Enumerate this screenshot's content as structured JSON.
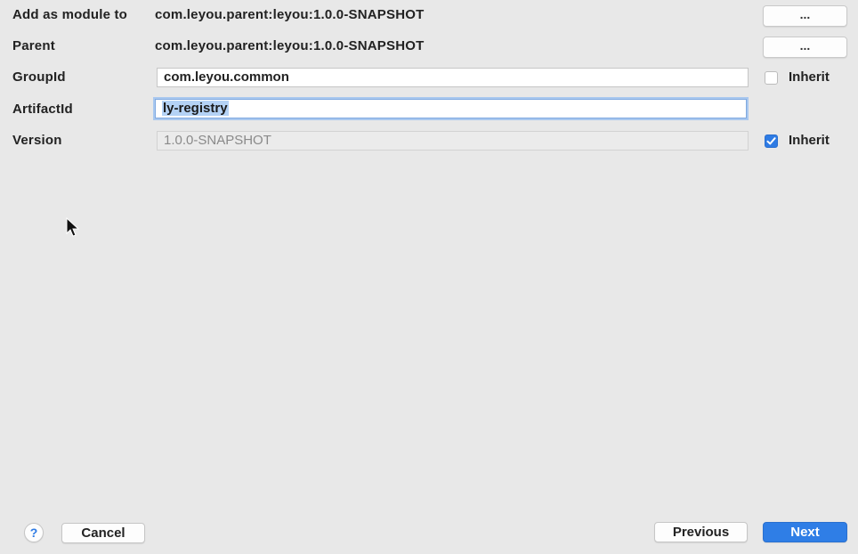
{
  "form": {
    "add_as_module": {
      "label": "Add as module to",
      "value": "com.leyou.parent:leyou:1.0.0-SNAPSHOT",
      "button_label": "..."
    },
    "parent": {
      "label": "Parent",
      "value": "com.leyou.parent:leyou:1.0.0-SNAPSHOT",
      "button_label": "..."
    },
    "group_id": {
      "label": "GroupId",
      "value": "com.leyou.common",
      "inherit_label": "Inherit",
      "inherit_checked": false
    },
    "artifact_id": {
      "label": "ArtifactId",
      "value": "ly-registry"
    },
    "version": {
      "label": "Version",
      "value": "1.0.0-SNAPSHOT",
      "inherit_label": "Inherit",
      "inherit_checked": true
    }
  },
  "footer": {
    "help_label": "?",
    "cancel_label": "Cancel",
    "previous_label": "Previous",
    "next_label": "Next"
  },
  "icons": {
    "cursor": "mouse-pointer-icon",
    "check": "check-icon"
  },
  "colors": {
    "accent": "#2f7ee6",
    "background": "#e8e8e8",
    "selection": "#b4d2f5"
  }
}
